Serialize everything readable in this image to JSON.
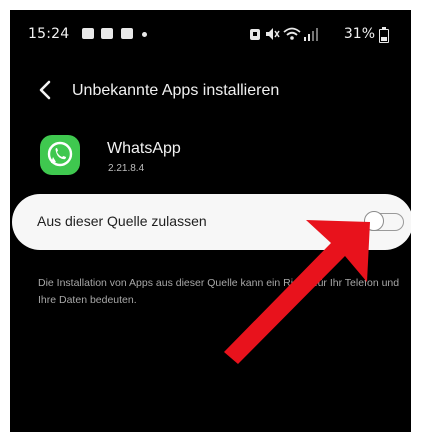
{
  "status_bar": {
    "time": "15:24",
    "battery": "31%",
    "notification_icons": [
      "image-icon",
      "notification-icon",
      "notification-icon"
    ],
    "system_icons": [
      "alarm-icon",
      "mute-icon",
      "wifi-icon",
      "signal-icon",
      "battery-icon"
    ]
  },
  "header": {
    "back_icon": "back-arrow-icon",
    "title": "Unbekannte Apps installieren"
  },
  "app": {
    "icon": "whatsapp-icon",
    "name": "WhatsApp",
    "version": "2.21.8.4"
  },
  "toggle": {
    "label": "Aus dieser Quelle zulassen",
    "enabled": false
  },
  "warning": {
    "text": "Die Installation von Apps aus dieser Quelle kann ein Risiko für Ihr Telefon und Ihre Daten bedeuten."
  },
  "colors": {
    "background": "#000000",
    "card": "#f7f7f7",
    "whatsapp_green": "#3fc84f",
    "arrow": "#e8121c"
  }
}
